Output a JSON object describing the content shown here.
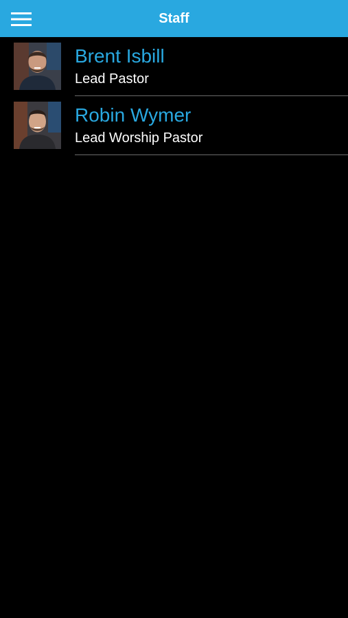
{
  "header": {
    "title": "Staff",
    "menu_icon": "hamburger-menu-icon",
    "background_color": "#29a8e0"
  },
  "staff": [
    {
      "name": "Brent Isbill",
      "role": "Lead Pastor",
      "photo": "avatar-photo"
    },
    {
      "name": "Robin Wymer",
      "role": "Lead Worship Pastor",
      "photo": "avatar-photo"
    }
  ],
  "colors": {
    "accent": "#29a8e0",
    "background": "#000000",
    "text": "#ffffff",
    "divider": "#6b6b6b"
  }
}
